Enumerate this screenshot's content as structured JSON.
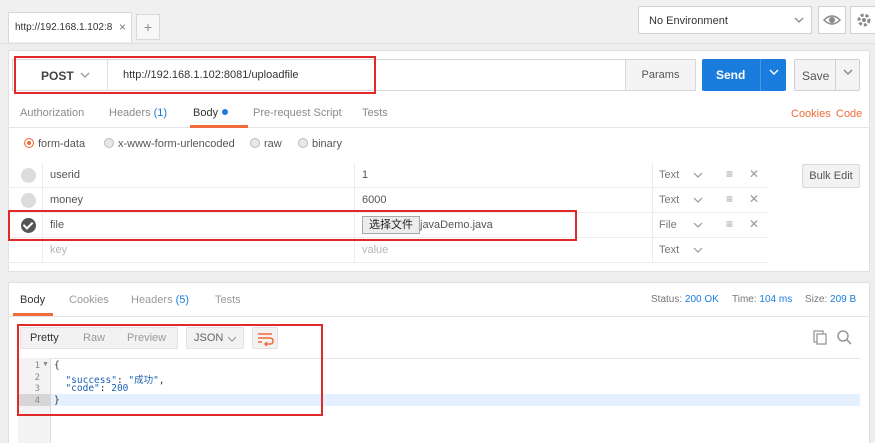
{
  "topbar": {
    "tab_title": "http://192.168.1.102:8",
    "tab_close": "×",
    "tab_add": "+",
    "environment": "No Environment"
  },
  "request": {
    "method": "POST",
    "url": "http://192.168.1.102:8081/uploadfile",
    "params_label": "Params",
    "send_label": "Send",
    "save_label": "Save"
  },
  "request_tabs": {
    "authorization": "Authorization",
    "headers": "Headers",
    "headers_count": "(1)",
    "body": "Body",
    "pre_request": "Pre-request Script",
    "tests": "Tests",
    "cookies": "Cookies",
    "code": "Code"
  },
  "body_modes": {
    "form_data": "form-data",
    "urlencoded": "x-www-form-urlencoded",
    "raw": "raw",
    "binary": "binary",
    "selected": "form-data"
  },
  "form_rows": [
    {
      "key": "userid",
      "value": "1",
      "type": "Text",
      "checked": false
    },
    {
      "key": "money",
      "value": "6000",
      "type": "Text",
      "checked": false
    },
    {
      "key": "file",
      "choose_label": "选择文件",
      "file_name": "javaDemo.java",
      "type": "File",
      "checked": true
    },
    {
      "key_placeholder": "key",
      "value_placeholder": "value",
      "type": "Text"
    }
  ],
  "bulk_edit_label": "Bulk Edit",
  "response": {
    "tabs": {
      "body": "Body",
      "cookies": "Cookies",
      "headers": "Headers",
      "headers_count": "(5)",
      "tests": "Tests"
    },
    "status_label": "Status:",
    "status_value": "200 OK",
    "time_label": "Time:",
    "time_value": "104 ms",
    "size_label": "Size:",
    "size_value": "209 B",
    "view_modes": {
      "pretty": "Pretty",
      "raw": "Raw",
      "preview": "Preview"
    },
    "format": "JSON",
    "code_lines": [
      "1",
      "2",
      "3",
      "4"
    ],
    "code": {
      "open_brace": "{",
      "success_key": "\"success\"",
      "success_value": "\"成功\"",
      "code_key": "\"code\"",
      "code_value": "200",
      "close_brace": "}"
    }
  },
  "colors": {
    "accent": "#f26b3a",
    "primary": "#1a7cdd",
    "highlight": "#e02a2a"
  }
}
